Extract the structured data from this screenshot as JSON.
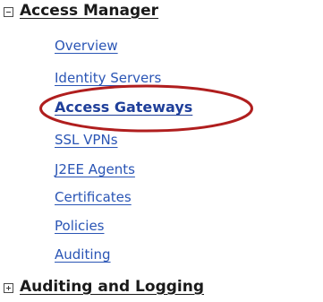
{
  "sections": [
    {
      "title": "Access Manager",
      "toggle": "collapse-icon",
      "expanded": true,
      "items": [
        {
          "label": "Overview",
          "active": false
        },
        {
          "label": "Identity Servers",
          "active": false
        },
        {
          "label": "Access Gateways",
          "active": true
        },
        {
          "label": "SSL VPNs",
          "active": false
        },
        {
          "label": "J2EE Agents",
          "active": false
        },
        {
          "label": "Certificates",
          "active": false
        },
        {
          "label": "Policies",
          "active": false
        },
        {
          "label": "Auditing",
          "active": false
        }
      ]
    },
    {
      "title": "Auditing and Logging",
      "toggle": "expand-icon",
      "expanded": false,
      "items": []
    }
  ],
  "colors": {
    "link": "#2a55b5",
    "active_link": "#1f3f9a",
    "heading": "#1a1a1a",
    "highlight": "#b01e1e"
  }
}
